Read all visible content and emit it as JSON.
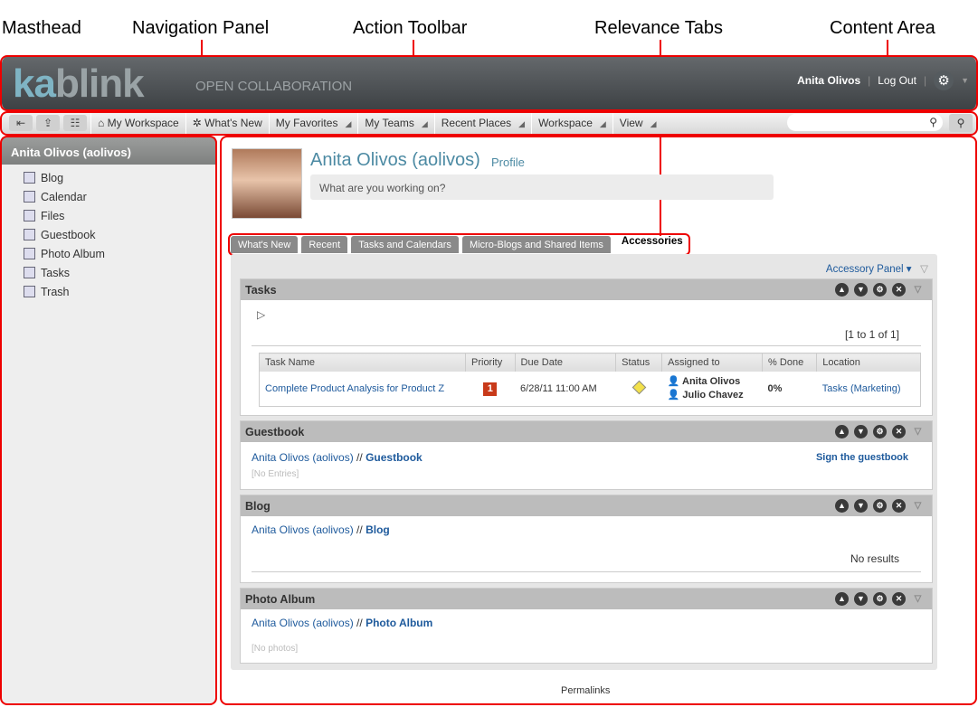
{
  "callouts": {
    "masthead": "Masthead",
    "navigation": "Navigation Panel",
    "toolbar": "Action Toolbar",
    "tabs": "Relevance Tabs",
    "content": "Content Area"
  },
  "masthead": {
    "logo": "kablink",
    "tagline": "OPEN COLLABORATION",
    "user": "Anita Olivos",
    "logout": "Log Out"
  },
  "toolbar": {
    "items": [
      {
        "label": "My Workspace"
      },
      {
        "label": "What's New"
      },
      {
        "label": "My Favorites"
      },
      {
        "label": "My Teams"
      },
      {
        "label": "Recent Places"
      },
      {
        "label": "Workspace"
      },
      {
        "label": "View"
      }
    ],
    "search_value": ""
  },
  "nav": {
    "title": "Anita Olivos (aolivos)",
    "items": [
      {
        "label": "Blog"
      },
      {
        "label": "Calendar"
      },
      {
        "label": "Files"
      },
      {
        "label": "Guestbook"
      },
      {
        "label": "Photo Album"
      },
      {
        "label": "Tasks"
      },
      {
        "label": "Trash"
      }
    ]
  },
  "profile": {
    "name": "Anita Olivos (aolivos)",
    "profile_link": "Profile",
    "status_placeholder": "What are you working on?"
  },
  "tabs": [
    {
      "label": "What's New"
    },
    {
      "label": "Recent"
    },
    {
      "label": "Tasks and Calendars"
    },
    {
      "label": "Micro-Blogs and Shared Items"
    },
    {
      "label": "Accessories"
    }
  ],
  "accessory_panel": "Accessory Panel",
  "tasks": {
    "title": "Tasks",
    "paging": "[1 to 1 of 1]",
    "columns": [
      "Task Name",
      "Priority",
      "Due Date",
      "Status",
      "Assigned to",
      "% Done",
      "Location"
    ],
    "rows": [
      {
        "name": "Complete Product Analysis for Product Z",
        "priority": "1",
        "due": "6/28/11 11:00 AM",
        "assigned": [
          "Anita Olivos",
          "Julio Chavez"
        ],
        "done": "0%",
        "location": "Tasks (Marketing)"
      }
    ]
  },
  "guestbook": {
    "title": "Guestbook",
    "owner": "Anita Olivos (aolivos)",
    "sep": " // ",
    "section": "Guestbook",
    "sign": "Sign the guestbook",
    "empty": "[No Entries]"
  },
  "blog": {
    "title": "Blog",
    "owner": "Anita Olivos (aolivos)",
    "sep": " // ",
    "section": "Blog",
    "empty": "No results"
  },
  "photo": {
    "title": "Photo Album",
    "owner": "Anita Olivos (aolivos)",
    "sep": " // ",
    "section": "Photo Album",
    "empty": "[No photos]"
  },
  "footer": {
    "permalinks": "Permalinks"
  }
}
